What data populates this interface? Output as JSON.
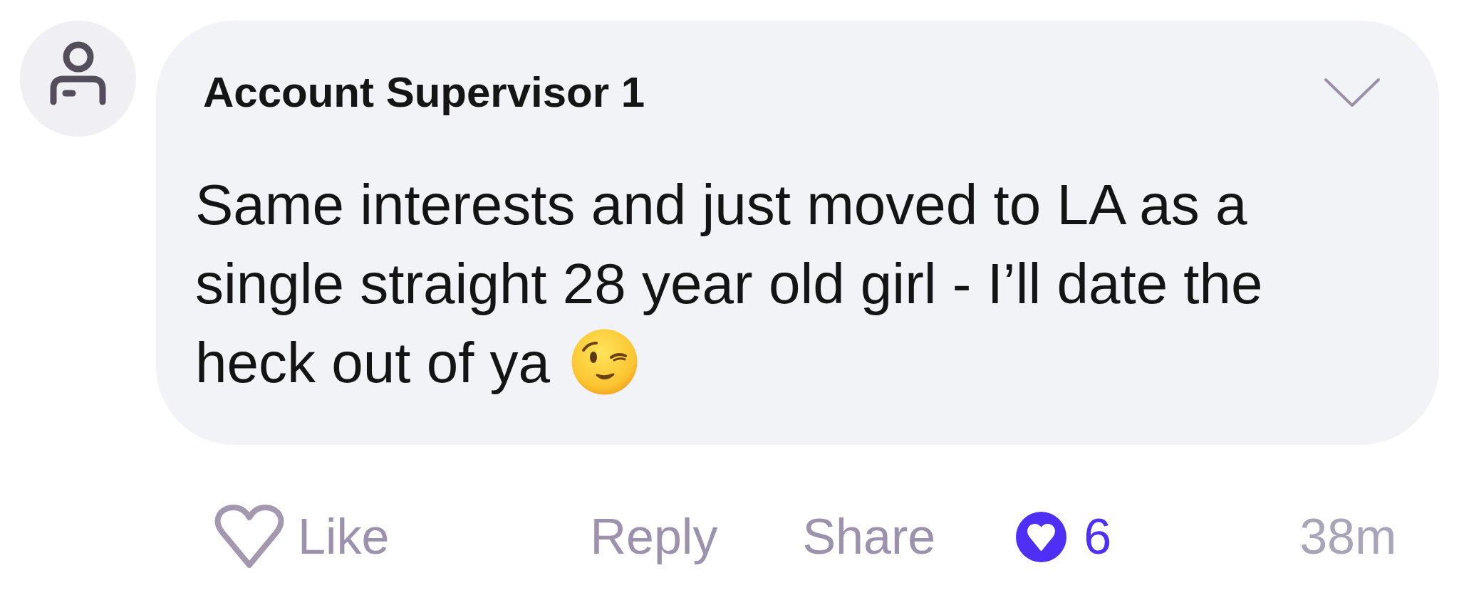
{
  "comment": {
    "author": "Account Supervisor 1",
    "text": "Same interests and just moved to LA as a single straight 28 year old girl - I’ll date the heck out of ya",
    "actions": [
      {
        "kind": "like",
        "label": "Like",
        "liked": false
      },
      {
        "kind": "reply",
        "label": "Reply"
      },
      {
        "kind": "share",
        "label": "Share"
      }
    ],
    "reactions": {
      "count": "6"
    },
    "time": "38m"
  }
}
